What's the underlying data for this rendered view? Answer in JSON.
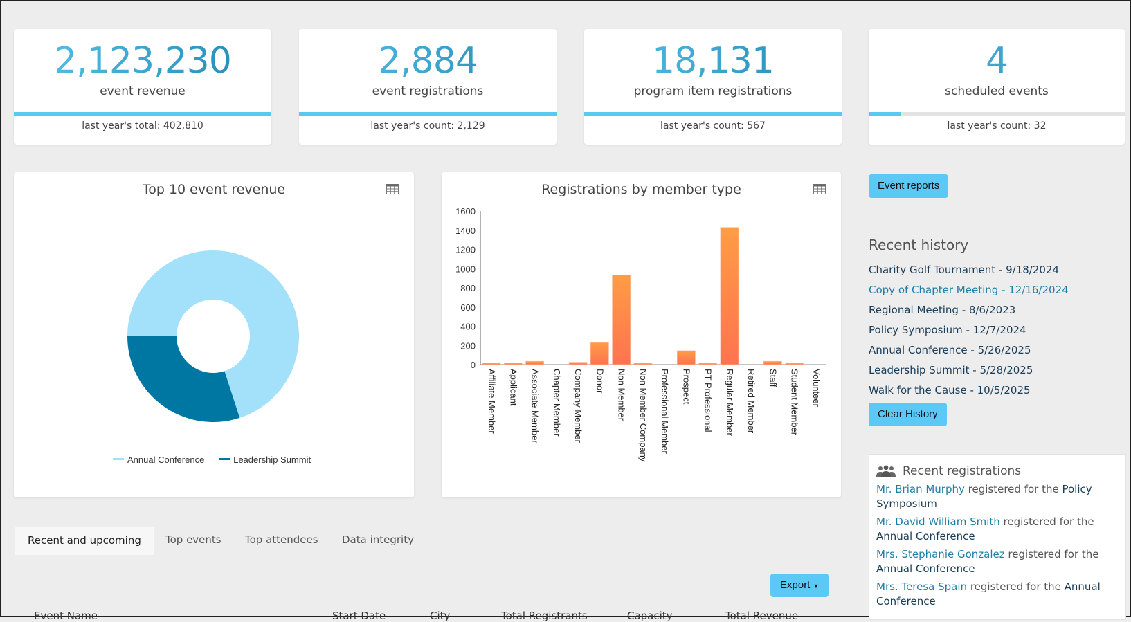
{
  "kpis": [
    {
      "value": "2,123,230",
      "label": "event revenue",
      "sub": "last year's total: 402,810",
      "progress_pct": 100
    },
    {
      "value": "2,884",
      "label": "event registrations",
      "sub": "last year's count: 2,129",
      "progress_pct": 100
    },
    {
      "value": "18,131",
      "label": "program item registrations",
      "sub": "last year's count: 567",
      "progress_pct": 100
    },
    {
      "value": "4",
      "label": "scheduled events",
      "sub": "last year's count: 32",
      "progress_pct": 12.5
    }
  ],
  "panels": {
    "revenue": {
      "title": "Top 10 event revenue",
      "table_icon": "table-icon"
    },
    "member_type": {
      "title": "Registrations by member type",
      "table_icon": "table-icon"
    }
  },
  "chart_data": [
    {
      "type": "pie",
      "subtype": "donut",
      "title": "Top 10 event revenue",
      "labels": [
        "Annual Conference",
        "Leadership Summit"
      ],
      "values": [
        70,
        30
      ],
      "unit": "percent (estimated)",
      "colors": [
        "#a3e1fa",
        "#0077a2"
      ],
      "legend": "bottom"
    },
    {
      "type": "bar",
      "title": "Registrations by member type",
      "categories": [
        "Affiliate Member",
        "Applicant",
        "Associate Member",
        "Chapter Member",
        "Company Member",
        "Donor",
        "Non Member",
        "Non Member Company",
        "Professional Member",
        "Prospect",
        "PT Professional",
        "Regular Member",
        "Retired Member",
        "Staff",
        "Student Member",
        "Volunteer"
      ],
      "values": [
        15,
        15,
        35,
        0,
        25,
        230,
        935,
        8,
        0,
        145,
        8,
        1430,
        0,
        35,
        8,
        0
      ],
      "xlabel": "",
      "ylabel": "",
      "ylim": [
        0,
        1600
      ],
      "yticks": [
        0,
        200,
        400,
        600,
        800,
        1000,
        1200,
        1400,
        1600
      ],
      "grid": false,
      "colors": [
        "#ff9c45",
        "#ff7350"
      ]
    }
  ],
  "sidebar": {
    "event_reports_label": "Event reports",
    "recent_history_title": "Recent history",
    "history": [
      "Charity Golf Tournament - 9/18/2024",
      "Copy of Chapter Meeting - 12/16/2024",
      "Regional Meeting - 8/6/2023",
      "Policy Symposium - 12/7/2024",
      "Annual Conference - 5/26/2025",
      "Leadership Summit - 5/28/2025",
      "Walk for the Cause - 10/5/2025"
    ],
    "clear_history_label": "Clear History",
    "recent_registrations_title": "Recent registrations",
    "registrations": [
      {
        "person": "Mr. Brian Murphy",
        "text": " registered for the ",
        "event": "Policy Symposium"
      },
      {
        "person": "Mr. David William Smith",
        "text": " registered for the ",
        "event": "Annual Conference"
      },
      {
        "person": "Mrs. Stephanie Gonzalez",
        "text": " registered for the ",
        "event": "Annual Conference"
      },
      {
        "person": "Mrs. Teresa Spain",
        "text": " registered for the ",
        "event": "Annual Conference"
      }
    ]
  },
  "tabs": [
    "Recent and upcoming",
    "Top events",
    "Top attendees",
    "Data integrity"
  ],
  "active_tab": 0,
  "export_label": "Export",
  "table": {
    "columns": [
      "Event Name",
      "Start Date",
      "City",
      "Total Registrants",
      "Capacity",
      "Total Revenue"
    ]
  }
}
